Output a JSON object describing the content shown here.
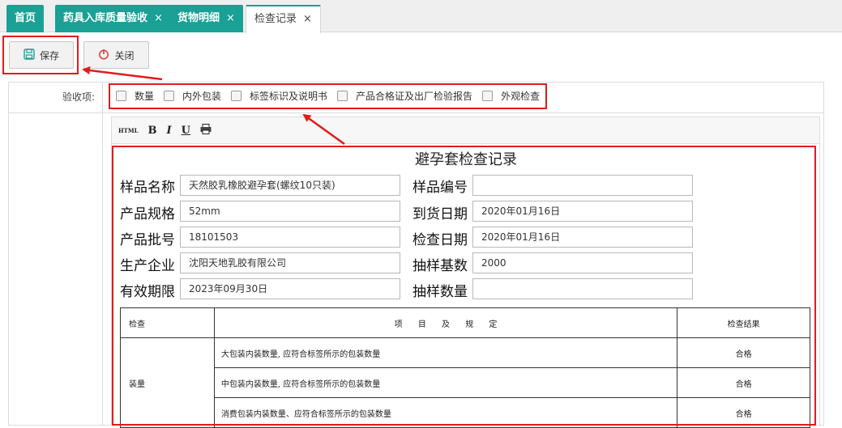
{
  "tabs": [
    {
      "label": "首页",
      "closable": false
    },
    {
      "label": "药具入库质量验收",
      "closable": true
    },
    {
      "label": "货物明细",
      "closable": true
    },
    {
      "label": "检查记录",
      "closable": true,
      "active": true
    }
  ],
  "tab_close_glyph": "×",
  "toolbar": {
    "save_label": "保存",
    "close_label": "关闭"
  },
  "form": {
    "acceptance_label": "验收项:",
    "check_items": [
      "数量",
      "内外包装",
      "标签标识及说明书",
      "产品合格证及出厂检验报告",
      "外观检查"
    ]
  },
  "editor_toolbar": {
    "html": "HTML",
    "bold": "B",
    "italic": "I",
    "underline": "U"
  },
  "record": {
    "title": "避孕套检查记录",
    "fields": [
      {
        "label": "样品名称",
        "value": "天然胶乳橡胶避孕套(螺纹10只装)"
      },
      {
        "label": "样品编号",
        "value": ""
      },
      {
        "label": "产品规格",
        "value": "52mm"
      },
      {
        "label": "到货日期",
        "value": "2020年01月16日"
      },
      {
        "label": "产品批号",
        "value": "18101503"
      },
      {
        "label": "检查日期",
        "value": "2020年01月16日"
      },
      {
        "label": "生产企业",
        "value": "沈阳天地乳胶有限公司"
      },
      {
        "label": "抽样基数",
        "value": "2000"
      },
      {
        "label": "有效期限",
        "value": "2023年09月30日"
      },
      {
        "label": "抽样数量",
        "value": ""
      }
    ],
    "table": {
      "headers": [
        "检查",
        "项 目 及 规 定",
        "检查结果"
      ],
      "group": "装量",
      "rows": [
        {
          "item": "大包装内装数量, 应符合标签所示的包装数量",
          "result": "合格"
        },
        {
          "item": "中包装内装数量, 应符合标签所示的包装数量",
          "result": "合格"
        },
        {
          "item": "消费包装内装数量、应符合标签所示的包装数量",
          "result": "合格"
        }
      ]
    }
  },
  "colors": {
    "tab_bg": "#1aa094",
    "highlight_red": "#e21b1b"
  }
}
